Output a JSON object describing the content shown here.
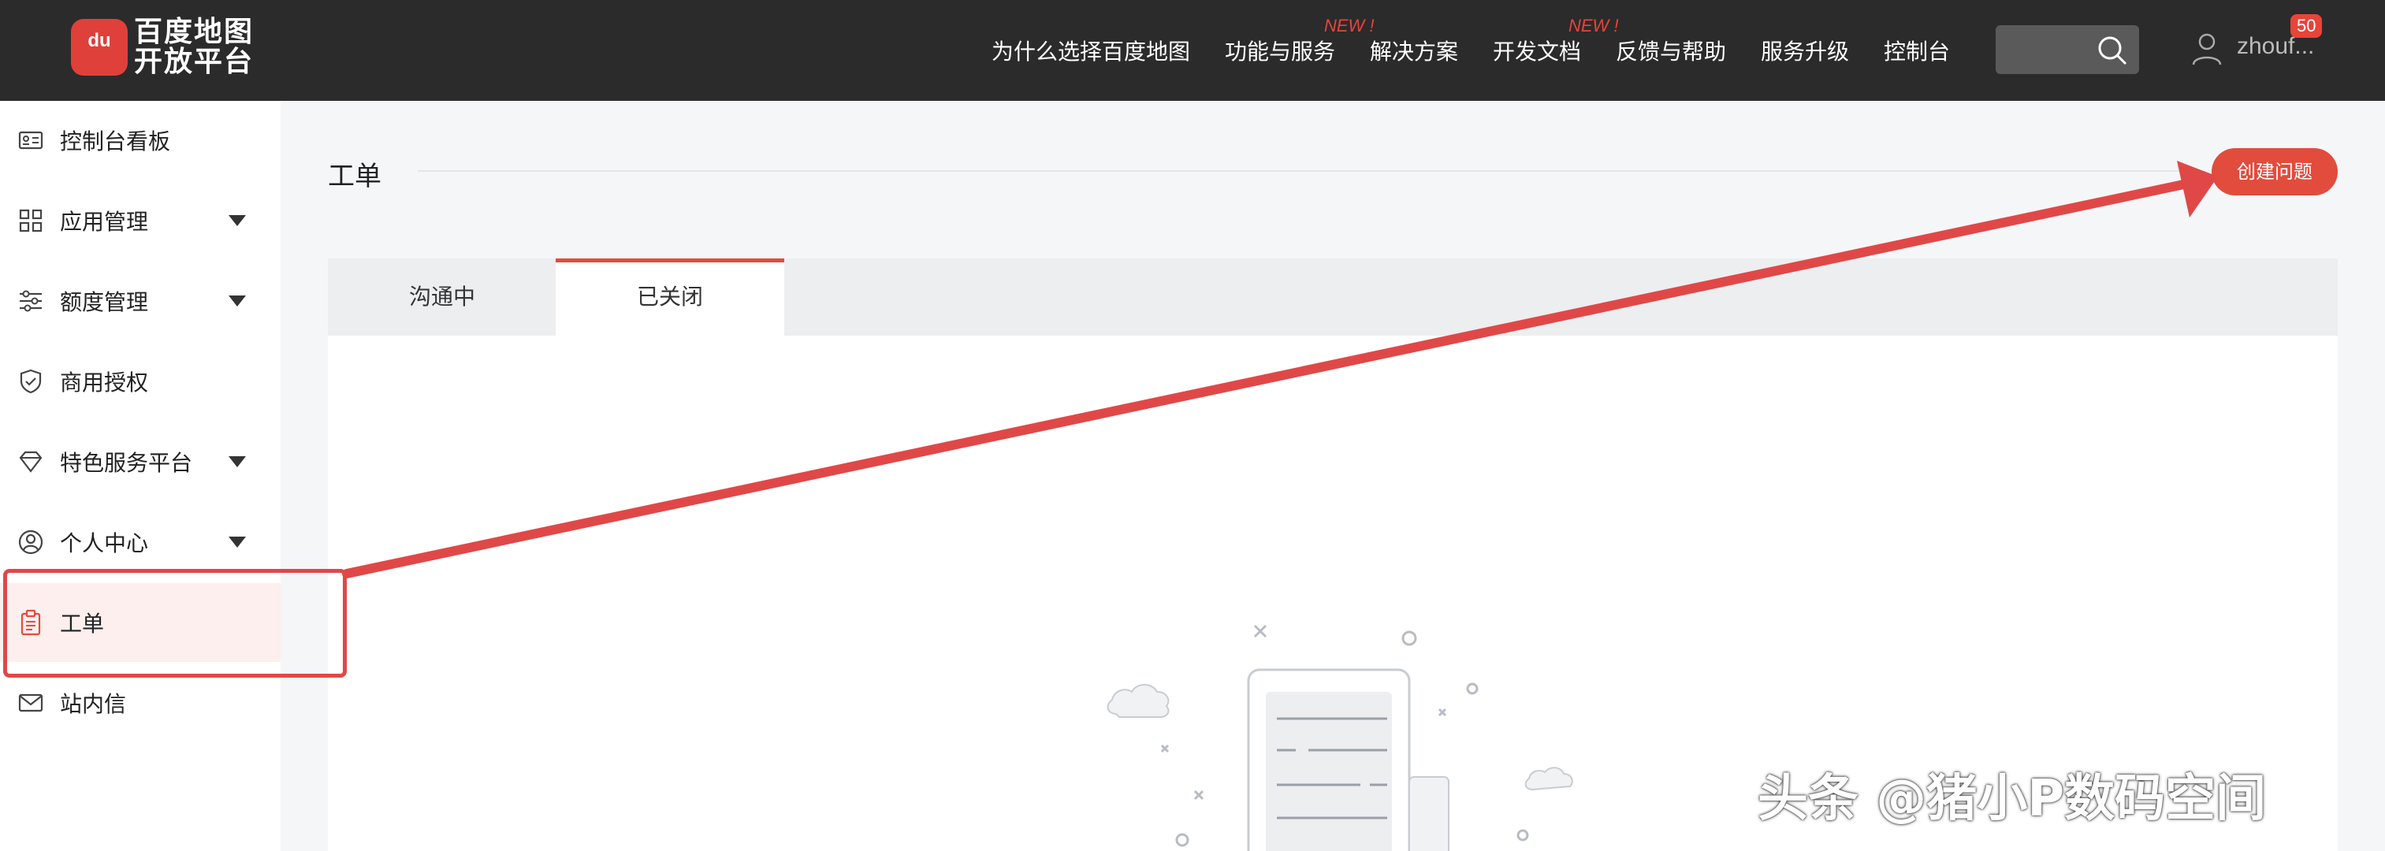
{
  "header": {
    "logo_text_line1": "百度地图",
    "logo_text_line2": "开放平台",
    "logo_badge": "du",
    "nav": [
      {
        "label": "为什么选择百度地图",
        "new": ""
      },
      {
        "label": "功能与服务",
        "new": "NEW !"
      },
      {
        "label": "解决方案",
        "new": ""
      },
      {
        "label": "开发文档",
        "new": "NEW !"
      },
      {
        "label": "反馈与帮助",
        "new": ""
      },
      {
        "label": "服务升级",
        "new": ""
      },
      {
        "label": "控制台",
        "new": ""
      }
    ],
    "search_placeholder": "",
    "username": "zhouf...",
    "badge": "50"
  },
  "sidebar": {
    "items": [
      {
        "label": "控制台看板",
        "icon": "dashboard-card-icon",
        "caret": false
      },
      {
        "label": "应用管理",
        "icon": "grid-icon",
        "caret": true
      },
      {
        "label": "额度管理",
        "icon": "sliders-icon",
        "caret": true
      },
      {
        "label": "商用授权",
        "icon": "shield-check-icon",
        "caret": false
      },
      {
        "label": "特色服务平台",
        "icon": "diamond-icon",
        "caret": true
      },
      {
        "label": "个人中心",
        "icon": "user-circle-icon",
        "caret": true
      },
      {
        "label": "工单",
        "icon": "clipboard-icon",
        "caret": false,
        "active": true
      },
      {
        "label": "站内信",
        "icon": "mail-icon",
        "caret": false
      }
    ]
  },
  "main": {
    "title": "工单",
    "create_button": "创建问题",
    "tabs": [
      {
        "label": "沟通中",
        "active": false
      },
      {
        "label": "已关闭",
        "active": true
      }
    ]
  },
  "watermark": "头条 @猪小P数码空间",
  "colors": {
    "accent": "#e14c3d",
    "topbar": "#2b2b2b",
    "annotation": "#e04848"
  }
}
